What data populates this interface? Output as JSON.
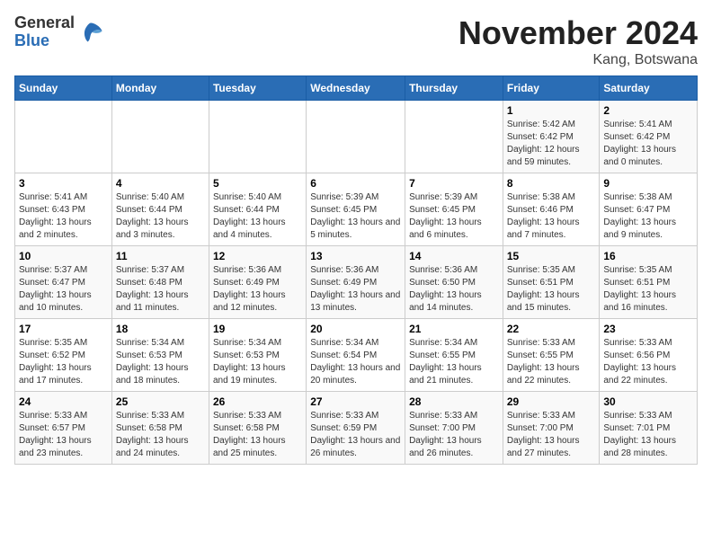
{
  "logo": {
    "general": "General",
    "blue": "Blue"
  },
  "title": "November 2024",
  "location": "Kang, Botswana",
  "days_of_week": [
    "Sunday",
    "Monday",
    "Tuesday",
    "Wednesday",
    "Thursday",
    "Friday",
    "Saturday"
  ],
  "weeks": [
    [
      {
        "day": "",
        "info": ""
      },
      {
        "day": "",
        "info": ""
      },
      {
        "day": "",
        "info": ""
      },
      {
        "day": "",
        "info": ""
      },
      {
        "day": "",
        "info": ""
      },
      {
        "day": "1",
        "info": "Sunrise: 5:42 AM\nSunset: 6:42 PM\nDaylight: 12 hours and 59 minutes."
      },
      {
        "day": "2",
        "info": "Sunrise: 5:41 AM\nSunset: 6:42 PM\nDaylight: 13 hours and 0 minutes."
      }
    ],
    [
      {
        "day": "3",
        "info": "Sunrise: 5:41 AM\nSunset: 6:43 PM\nDaylight: 13 hours and 2 minutes."
      },
      {
        "day": "4",
        "info": "Sunrise: 5:40 AM\nSunset: 6:44 PM\nDaylight: 13 hours and 3 minutes."
      },
      {
        "day": "5",
        "info": "Sunrise: 5:40 AM\nSunset: 6:44 PM\nDaylight: 13 hours and 4 minutes."
      },
      {
        "day": "6",
        "info": "Sunrise: 5:39 AM\nSunset: 6:45 PM\nDaylight: 13 hours and 5 minutes."
      },
      {
        "day": "7",
        "info": "Sunrise: 5:39 AM\nSunset: 6:45 PM\nDaylight: 13 hours and 6 minutes."
      },
      {
        "day": "8",
        "info": "Sunrise: 5:38 AM\nSunset: 6:46 PM\nDaylight: 13 hours and 7 minutes."
      },
      {
        "day": "9",
        "info": "Sunrise: 5:38 AM\nSunset: 6:47 PM\nDaylight: 13 hours and 9 minutes."
      }
    ],
    [
      {
        "day": "10",
        "info": "Sunrise: 5:37 AM\nSunset: 6:47 PM\nDaylight: 13 hours and 10 minutes."
      },
      {
        "day": "11",
        "info": "Sunrise: 5:37 AM\nSunset: 6:48 PM\nDaylight: 13 hours and 11 minutes."
      },
      {
        "day": "12",
        "info": "Sunrise: 5:36 AM\nSunset: 6:49 PM\nDaylight: 13 hours and 12 minutes."
      },
      {
        "day": "13",
        "info": "Sunrise: 5:36 AM\nSunset: 6:49 PM\nDaylight: 13 hours and 13 minutes."
      },
      {
        "day": "14",
        "info": "Sunrise: 5:36 AM\nSunset: 6:50 PM\nDaylight: 13 hours and 14 minutes."
      },
      {
        "day": "15",
        "info": "Sunrise: 5:35 AM\nSunset: 6:51 PM\nDaylight: 13 hours and 15 minutes."
      },
      {
        "day": "16",
        "info": "Sunrise: 5:35 AM\nSunset: 6:51 PM\nDaylight: 13 hours and 16 minutes."
      }
    ],
    [
      {
        "day": "17",
        "info": "Sunrise: 5:35 AM\nSunset: 6:52 PM\nDaylight: 13 hours and 17 minutes."
      },
      {
        "day": "18",
        "info": "Sunrise: 5:34 AM\nSunset: 6:53 PM\nDaylight: 13 hours and 18 minutes."
      },
      {
        "day": "19",
        "info": "Sunrise: 5:34 AM\nSunset: 6:53 PM\nDaylight: 13 hours and 19 minutes."
      },
      {
        "day": "20",
        "info": "Sunrise: 5:34 AM\nSunset: 6:54 PM\nDaylight: 13 hours and 20 minutes."
      },
      {
        "day": "21",
        "info": "Sunrise: 5:34 AM\nSunset: 6:55 PM\nDaylight: 13 hours and 21 minutes."
      },
      {
        "day": "22",
        "info": "Sunrise: 5:33 AM\nSunset: 6:55 PM\nDaylight: 13 hours and 22 minutes."
      },
      {
        "day": "23",
        "info": "Sunrise: 5:33 AM\nSunset: 6:56 PM\nDaylight: 13 hours and 22 minutes."
      }
    ],
    [
      {
        "day": "24",
        "info": "Sunrise: 5:33 AM\nSunset: 6:57 PM\nDaylight: 13 hours and 23 minutes."
      },
      {
        "day": "25",
        "info": "Sunrise: 5:33 AM\nSunset: 6:58 PM\nDaylight: 13 hours and 24 minutes."
      },
      {
        "day": "26",
        "info": "Sunrise: 5:33 AM\nSunset: 6:58 PM\nDaylight: 13 hours and 25 minutes."
      },
      {
        "day": "27",
        "info": "Sunrise: 5:33 AM\nSunset: 6:59 PM\nDaylight: 13 hours and 26 minutes."
      },
      {
        "day": "28",
        "info": "Sunrise: 5:33 AM\nSunset: 7:00 PM\nDaylight: 13 hours and 26 minutes."
      },
      {
        "day": "29",
        "info": "Sunrise: 5:33 AM\nSunset: 7:00 PM\nDaylight: 13 hours and 27 minutes."
      },
      {
        "day": "30",
        "info": "Sunrise: 5:33 AM\nSunset: 7:01 PM\nDaylight: 13 hours and 28 minutes."
      }
    ]
  ]
}
